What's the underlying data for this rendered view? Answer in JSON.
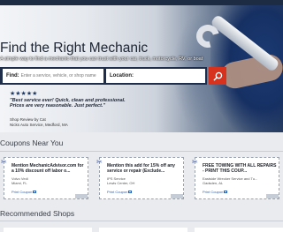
{
  "hero": {
    "title": "Find the Right Mechanic",
    "subtitle": "A simple way to find a mechanic that you can trust with your car, truck, motorcycle, RV, or boat",
    "search": {
      "find_label": "Find:",
      "find_placeholder": "Enter a service, vehicle, or shop name",
      "location_label": "Location:",
      "location_placeholder": ""
    },
    "review": {
      "stars": "★★★★★",
      "rating": 5,
      "quote": "\"Best service ever! Quick, clean and professional. Prices are very reasonable. Just perfect.\"",
      "reviewer": "Shop Review by Cat",
      "shop": "Nicks Auto Service, Medford, MA"
    }
  },
  "coupons": {
    "title": "Coupons Near You",
    "items": [
      {
        "headline": "Mention MechanicAdvisor.com for a 10% discount off labor o...",
        "shop": "Volvo Vedi",
        "city": "Miami, FL",
        "print_label": "Print Coupon"
      },
      {
        "headline": "Mention this add for 15% off any service or repair (Exclude...",
        "shop": "IPS Service",
        "city": "Lewis Center, OH",
        "print_label": "Print Coupon"
      },
      {
        "headline": "FREE TOWING WITH ALL REPAIRS - PRINT THIS COUP...",
        "shop": "Eastside Wrecker Service and Tu...",
        "city": "Gadsden, AL",
        "print_label": "Print Coupon"
      }
    ]
  },
  "recommended": {
    "title": "Recommended Shops"
  },
  "colors": {
    "nav": "#1d2b43",
    "search_bar": "#1d2d4a",
    "go_button": "#d6321d",
    "link": "#2a5fb0"
  }
}
